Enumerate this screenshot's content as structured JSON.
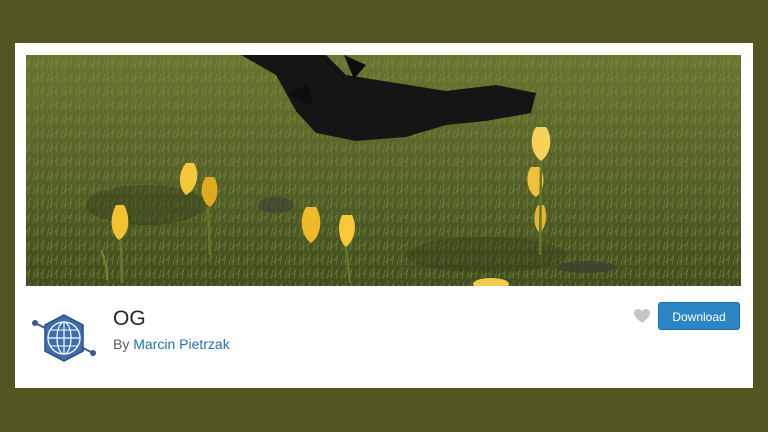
{
  "banner": {
    "image_description_icon": "photo-banner"
  },
  "plugin": {
    "name": "OG",
    "author_prefix": "By",
    "author_name": "Marcin Pietrzak"
  },
  "actions": {
    "favorite_icon": "heart-icon",
    "download_label": "Download"
  },
  "colors": {
    "background": "#525620",
    "card": "#ffffff",
    "download_button": "#2a86c5",
    "author_link": "#2271b1",
    "icon_blue": "#3c6fb0"
  }
}
